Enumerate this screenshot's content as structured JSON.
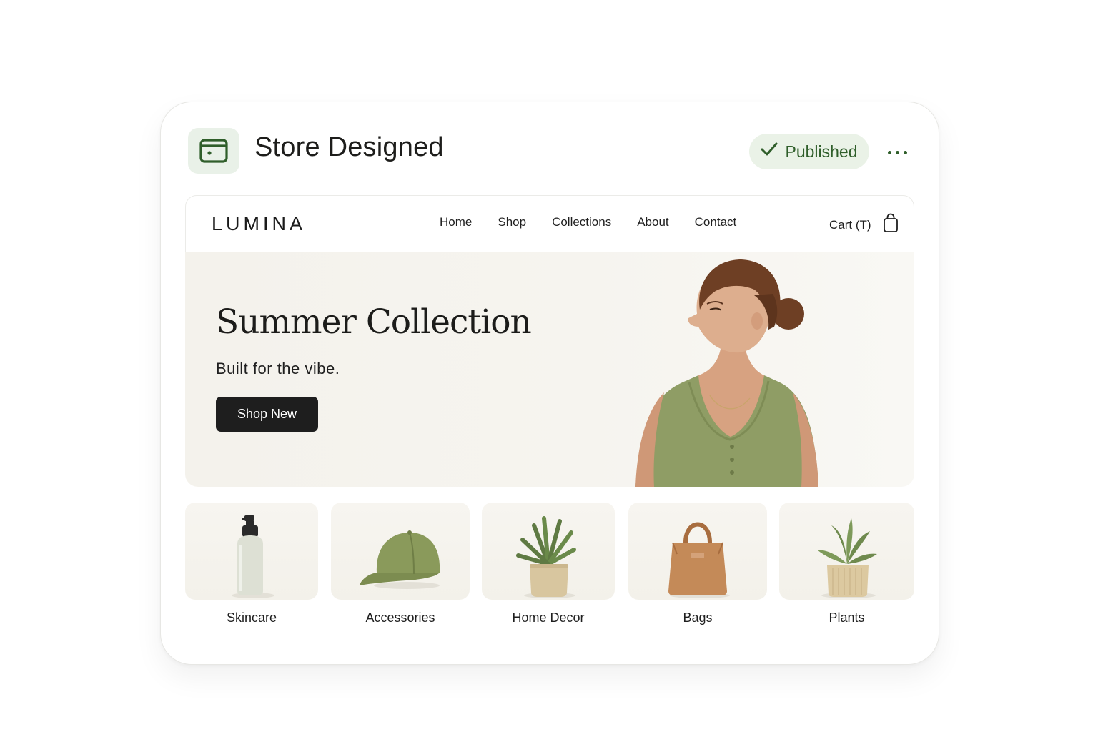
{
  "card": {
    "title": "Store Designed",
    "app_icon": "browser-window-icon",
    "status_label": "Published",
    "status_icon": "check-icon",
    "more_icon": "more-horizontal-icon"
  },
  "store": {
    "brand": "LUMINA",
    "nav": [
      "Home",
      "Shop",
      "Collections",
      "About",
      "Contact"
    ],
    "cart_label": "Cart (T)",
    "cart_icon": "shopping-bag-icon"
  },
  "hero": {
    "title": "Summer Collection",
    "subtitle": "Built for the vibe.",
    "cta_label": "Shop New"
  },
  "categories": [
    {
      "label": "Skincare",
      "icon": "pump-bottle-icon"
    },
    {
      "label": "Accessories",
      "icon": "cap-icon"
    },
    {
      "label": "Home Decor",
      "icon": "potted-plant-icon"
    },
    {
      "label": "Bags",
      "icon": "tote-bag-icon"
    },
    {
      "label": "Plants",
      "icon": "potted-plant-icon"
    }
  ],
  "colors": {
    "accent_green": "#2f5e2a",
    "pill_bg": "#eaf2e7",
    "olive": "#8a9a5b",
    "button_dark": "#1e1e1e"
  }
}
